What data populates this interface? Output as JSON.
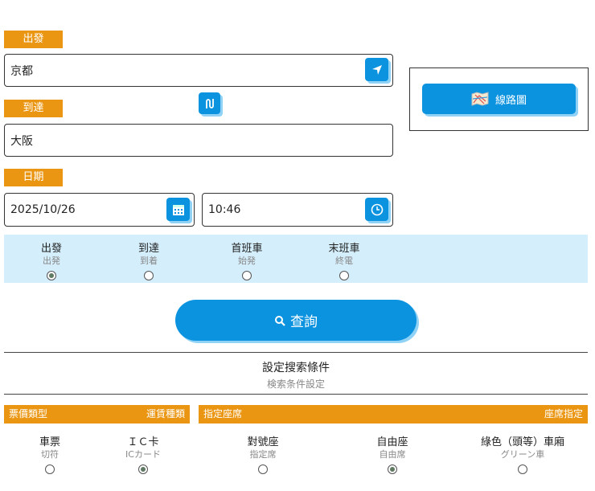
{
  "departure": {
    "label": "出發",
    "value": "京都"
  },
  "arrival": {
    "label": "到達",
    "value": "大阪"
  },
  "date": {
    "label": "日期",
    "date_value": "2025/10/26",
    "time_value": "10:46"
  },
  "route_map": {
    "label": "線路圖"
  },
  "time_mode": [
    {
      "label": "出發",
      "sub": "出発",
      "selected": true
    },
    {
      "label": "到達",
      "sub": "到着",
      "selected": false
    },
    {
      "label": "首班車",
      "sub": "始発",
      "selected": false
    },
    {
      "label": "末班車",
      "sub": "終電",
      "selected": false
    }
  ],
  "search": {
    "label": "查詢"
  },
  "settings": {
    "title": "設定搜索條件",
    "subtitle": "検索条件設定"
  },
  "fare_type": {
    "title": "票價類型",
    "title_jp": "運賃種類",
    "options": [
      {
        "label": "車票",
        "sub": "切符",
        "selected": false
      },
      {
        "label": "ＩＣ卡",
        "sub": "ICカード",
        "selected": true
      }
    ]
  },
  "seat_type": {
    "title": "指定座席",
    "title_jp": "座席指定",
    "options": [
      {
        "label": "對號座",
        "sub": "指定席",
        "selected": false
      },
      {
        "label": "自由座",
        "sub": "自由席",
        "selected": true
      },
      {
        "label": "綠色（頭等）車廂",
        "sub": "グリーン車",
        "selected": false
      }
    ]
  }
}
